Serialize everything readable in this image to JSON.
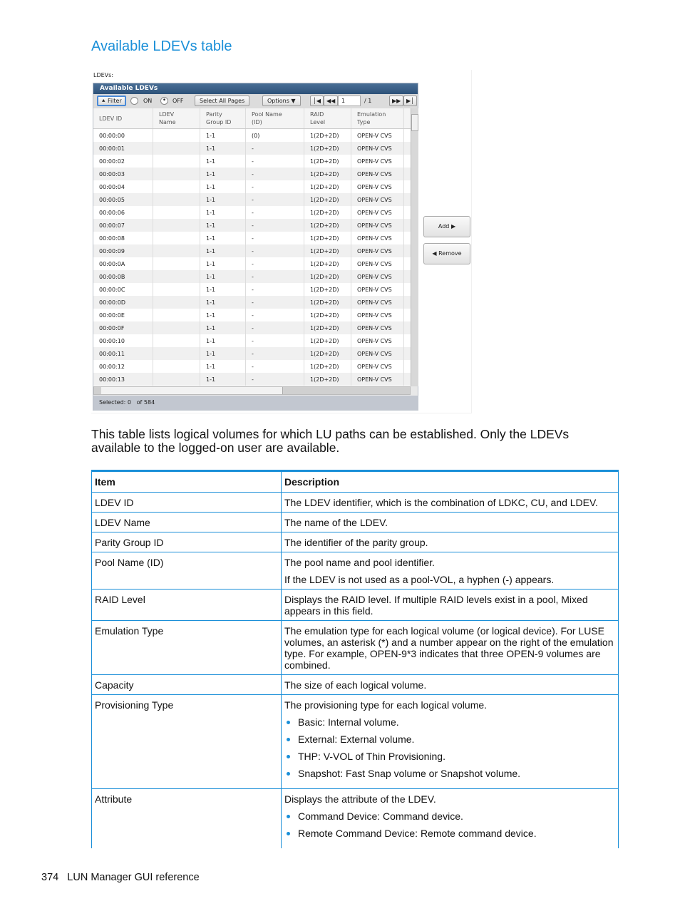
{
  "section_title": "Available LDEVs table",
  "screenshot": {
    "label": "LDEVs:",
    "panel_title": "Available LDEVs",
    "toolbar": {
      "filter": "Filter",
      "on": "ON",
      "off": "OFF",
      "filter_state": "OFF",
      "select_all": "Select All Pages",
      "options": "Options",
      "page": "1",
      "page_total": "/ 1"
    },
    "columns": [
      [
        "LDEV ID",
        ""
      ],
      [
        "LDEV",
        "Name"
      ],
      [
        "Parity",
        "Group ID"
      ],
      [
        "Pool Name",
        "(ID)"
      ],
      [
        "RAID",
        "Level"
      ],
      [
        "Emulation",
        "Type"
      ]
    ],
    "rows": [
      [
        "00:00:00",
        "",
        "1-1",
        "(0)",
        "1(2D+2D)",
        "OPEN-V CVS"
      ],
      [
        "00:00:01",
        "",
        "1-1",
        "-",
        "1(2D+2D)",
        "OPEN-V CVS"
      ],
      [
        "00:00:02",
        "",
        "1-1",
        "-",
        "1(2D+2D)",
        "OPEN-V CVS"
      ],
      [
        "00:00:03",
        "",
        "1-1",
        "-",
        "1(2D+2D)",
        "OPEN-V CVS"
      ],
      [
        "00:00:04",
        "",
        "1-1",
        "-",
        "1(2D+2D)",
        "OPEN-V CVS"
      ],
      [
        "00:00:05",
        "",
        "1-1",
        "-",
        "1(2D+2D)",
        "OPEN-V CVS"
      ],
      [
        "00:00:06",
        "",
        "1-1",
        "-",
        "1(2D+2D)",
        "OPEN-V CVS"
      ],
      [
        "00:00:07",
        "",
        "1-1",
        "-",
        "1(2D+2D)",
        "OPEN-V CVS"
      ],
      [
        "00:00:08",
        "",
        "1-1",
        "-",
        "1(2D+2D)",
        "OPEN-V CVS"
      ],
      [
        "00:00:09",
        "",
        "1-1",
        "-",
        "1(2D+2D)",
        "OPEN-V CVS"
      ],
      [
        "00:00:0A",
        "",
        "1-1",
        "-",
        "1(2D+2D)",
        "OPEN-V CVS"
      ],
      [
        "00:00:0B",
        "",
        "1-1",
        "-",
        "1(2D+2D)",
        "OPEN-V CVS"
      ],
      [
        "00:00:0C",
        "",
        "1-1",
        "-",
        "1(2D+2D)",
        "OPEN-V CVS"
      ],
      [
        "00:00:0D",
        "",
        "1-1",
        "-",
        "1(2D+2D)",
        "OPEN-V CVS"
      ],
      [
        "00:00:0E",
        "",
        "1-1",
        "-",
        "1(2D+2D)",
        "OPEN-V CVS"
      ],
      [
        "00:00:0F",
        "",
        "1-1",
        "-",
        "1(2D+2D)",
        "OPEN-V CVS"
      ],
      [
        "00:00:10",
        "",
        "1-1",
        "-",
        "1(2D+2D)",
        "OPEN-V CVS"
      ],
      [
        "00:00:11",
        "",
        "1-1",
        "-",
        "1(2D+2D)",
        "OPEN-V CVS"
      ],
      [
        "00:00:12",
        "",
        "1-1",
        "-",
        "1(2D+2D)",
        "OPEN-V CVS"
      ],
      [
        "00:00:13",
        "",
        "1-1",
        "-",
        "1(2D+2D)",
        "OPEN-V CVS"
      ]
    ],
    "status": {
      "selected_label": "Selected:",
      "selected": "0",
      "of_label": "of",
      "total": "584"
    },
    "add": "Add",
    "remove": "Remove"
  },
  "paragraph": "This table lists logical volumes for which LU paths can be established. Only the LDEVs available to the logged-on user are available.",
  "table": {
    "headers": [
      "Item",
      "Description"
    ],
    "rows": [
      {
        "item": "LDEV ID",
        "desc": [
          "The LDEV identifier, which is the combination of LDKC, CU, and LDEV."
        ],
        "bullets": []
      },
      {
        "item": "LDEV Name",
        "desc": [
          "The name of the LDEV."
        ],
        "bullets": []
      },
      {
        "item": "Parity Group ID",
        "desc": [
          "The identifier of the parity group."
        ],
        "bullets": []
      },
      {
        "item": "Pool Name (ID)",
        "desc": [
          "The pool name and pool identifier.",
          "If the LDEV is not used as a pool-VOL, a hyphen (-) appears."
        ],
        "bullets": []
      },
      {
        "item": "RAID Level",
        "desc": [
          "Displays the RAID level. If multiple RAID levels exist in a pool, Mixed appears in this field."
        ],
        "bullets": []
      },
      {
        "item": "Emulation Type",
        "desc": [
          "The emulation type for each logical volume (or logical device). For LUSE volumes, an asterisk (*) and a number appear on the right of the emulation type. For example, OPEN-9*3 indicates that three OPEN-9 volumes are combined."
        ],
        "bullets": []
      },
      {
        "item": "Capacity",
        "desc": [
          "The size of each logical volume."
        ],
        "bullets": []
      },
      {
        "item": "Provisioning Type",
        "desc": [
          "The provisioning type for each logical volume."
        ],
        "bullets": [
          "Basic: Internal volume.",
          "External: External volume.",
          "THP: V-VOL of Thin Provisioning.",
          "Snapshot: Fast Snap volume or Snapshot volume."
        ]
      },
      {
        "item": "Attribute",
        "desc": [
          "Displays the attribute of the LDEV."
        ],
        "bullets": [
          "Command Device: Command device.",
          "Remote Command Device: Remote command device."
        ]
      }
    ]
  },
  "footer": {
    "page": "374",
    "title": "LUN Manager GUI reference"
  }
}
